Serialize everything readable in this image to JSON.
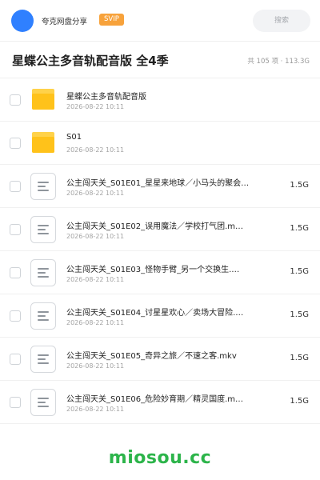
{
  "header": {
    "share_name": "夸克网盘分享",
    "badge": "SVIP",
    "search_placeholder": "搜索"
  },
  "title": {
    "text": "星蝶公主多音轨配音版 全4季",
    "summary": "共 105 项 · 113.3G"
  },
  "files": [
    {
      "type": "folder",
      "icon": "folder-icon",
      "name": "星蝶公主多音轨配音版",
      "date": "2026-08-22 10:11",
      "size": ""
    },
    {
      "type": "folder",
      "icon": "folder-icon",
      "name": "S01",
      "date": "2026-08-22 10:11",
      "size": ""
    },
    {
      "type": "file",
      "icon": "document-icon",
      "name": "公主闯天关_S01E01_星星来地球／小马头的聚会…",
      "date": "2026-08-22 10:11",
      "size": "1.5G"
    },
    {
      "type": "file",
      "icon": "document-icon",
      "name": "公主闯天关_S01E02_误用魔法／学校打气团.m…",
      "date": "2026-08-22 10:11",
      "size": "1.5G"
    },
    {
      "type": "file",
      "icon": "document-icon",
      "name": "公主闯天关_S01E03_怪物手臂_另一个交换生.…",
      "date": "2026-08-22 10:11",
      "size": "1.5G"
    },
    {
      "type": "file",
      "icon": "document-icon",
      "name": "公主闯天关_S01E04_讨星星欢心／卖场大冒险.…",
      "date": "2026-08-22 10:11",
      "size": "1.5G"
    },
    {
      "type": "file",
      "icon": "document-icon",
      "name": "公主闯天关_S01E05_奇异之旅／不速之客.mkv",
      "date": "2026-08-22 10:11",
      "size": "1.5G"
    },
    {
      "type": "file",
      "icon": "document-icon",
      "name": "公主闯天关_S01E06_危险妙育期／精灵国度.m…",
      "date": "2026-08-22 10:11",
      "size": "1.5G"
    }
  ],
  "watermark": "miosou.cc",
  "colors": {
    "avatar": "#2f80ff",
    "svip": "#f7a23b",
    "folder": "#ffc21a",
    "watermark": "#2cb44a"
  }
}
